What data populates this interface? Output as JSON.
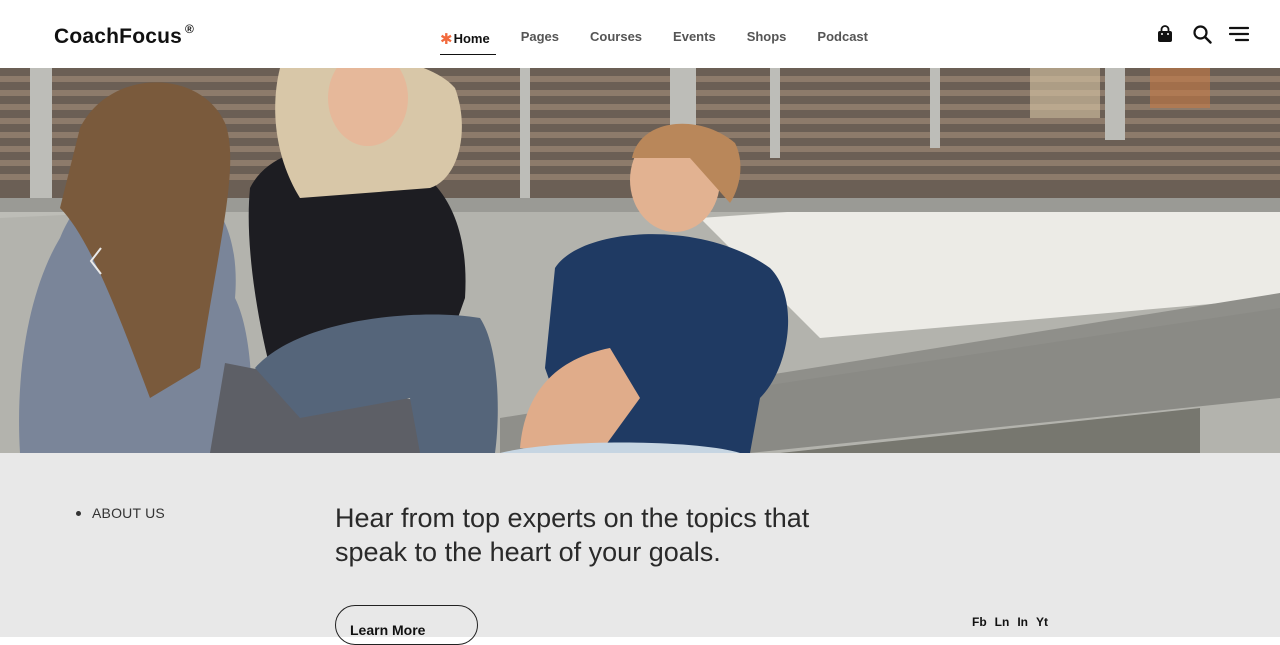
{
  "brand": {
    "name": "CoachFocus",
    "mark": "®"
  },
  "nav": {
    "items": [
      {
        "label": "Home",
        "active": true
      },
      {
        "label": "Pages"
      },
      {
        "label": "Courses"
      },
      {
        "label": "Events"
      },
      {
        "label": "Shops"
      },
      {
        "label": "Podcast"
      }
    ]
  },
  "header_icons": [
    "bag-icon",
    "search-icon",
    "menu-icon"
  ],
  "hero": {
    "image": "students-sitting-outdoors-photo",
    "arrow": "chevron-left-icon"
  },
  "sidebar": {
    "items": [
      {
        "label": "ABOUT US"
      }
    ]
  },
  "main": {
    "headline": "Hear from top experts on the topics that speak to the heart of your goals.",
    "cta_label": "Learn More"
  },
  "social": {
    "links": [
      "Fb",
      "Ln",
      "In",
      "Yt"
    ]
  },
  "colors": {
    "accent": "#f26a3d",
    "content_bg": "#e8e8e8",
    "text": "#111111"
  }
}
